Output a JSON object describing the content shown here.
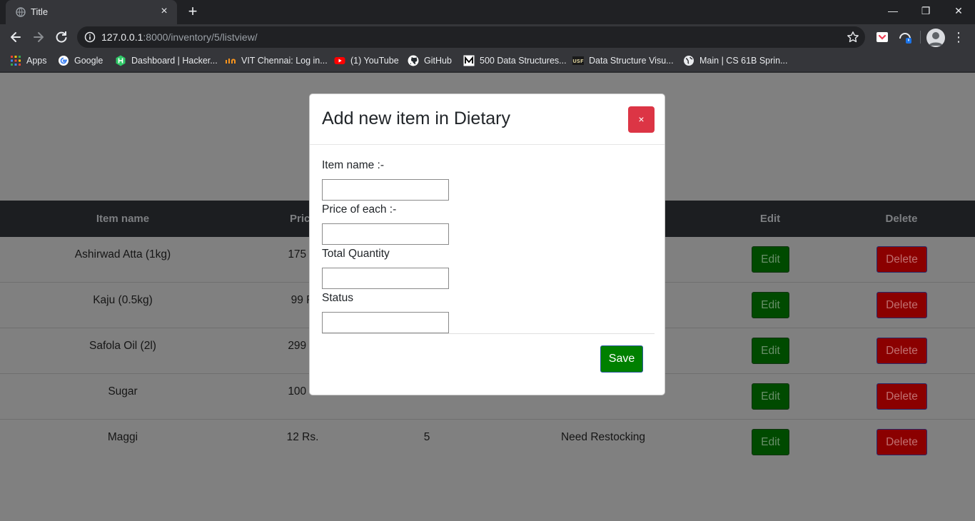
{
  "browser": {
    "tab_title": "Title",
    "tab_close": "×",
    "new_tab": "+",
    "url_host": "127.0.0.1",
    "url_path": ":8000/inventory/5/listview/",
    "window": {
      "minimize": "—",
      "restore": "❐",
      "close": "✕"
    },
    "menu": "⋮"
  },
  "bookmarks": [
    {
      "label": "Apps",
      "icon": "apps-grid-icon",
      "color": "#ea4335"
    },
    {
      "label": "Google",
      "icon": "google-icon",
      "color": "#4285f4"
    },
    {
      "label": "Dashboard | Hacker...",
      "icon": "hackerrank-icon",
      "color": "#2ec866"
    },
    {
      "label": "VIT Chennai: Log in...",
      "icon": "vit-icon",
      "color": "#f7941d"
    },
    {
      "label": "(1) YouTube",
      "icon": "youtube-icon",
      "color": "#ff0000"
    },
    {
      "label": "GitHub",
      "icon": "github-icon",
      "color": "#ffffff"
    },
    {
      "label": "500 Data Structures...",
      "icon": "medium-icon",
      "color": "#ffffff"
    },
    {
      "label": "Data Structure Visu...",
      "icon": "usf-icon",
      "color": "#cfc493"
    },
    {
      "label": "Main | CS 61B Sprin...",
      "icon": "globe-icon",
      "color": "#e8eaed"
    }
  ],
  "table": {
    "headers": [
      "Item name",
      "Pric",
      "Edit",
      "Delete"
    ],
    "rows": [
      {
        "name": "Ashirwad Atta (1kg)",
        "price": "175 R",
        "qty": "",
        "status": ""
      },
      {
        "name": "Kaju (0.5kg)",
        "price": "99 R",
        "qty": "",
        "status": ""
      },
      {
        "name": "Safola Oil (2l)",
        "price": "299 R",
        "qty": "",
        "status": ""
      },
      {
        "name": "Sugar",
        "price": "100 R",
        "qty": "",
        "status": ""
      },
      {
        "name": "Maggi",
        "price": "12 Rs.",
        "qty": "5",
        "status": "Need Restocking"
      }
    ],
    "edit_label": "Edit",
    "delete_label": "Delete"
  },
  "modal": {
    "title": "Add new item in Dietary",
    "close": "×",
    "fields": [
      {
        "label": "Item name :-",
        "value": ""
      },
      {
        "label": "Price of each :-",
        "value": ""
      },
      {
        "label": "Total Quantity",
        "value": ""
      },
      {
        "label": "Status",
        "value": ""
      }
    ],
    "save": "Save"
  },
  "colors": {
    "edit_button": "#004a00",
    "delete_button": "#8b0000",
    "close_button": "#dc3545",
    "save_button": "#008000",
    "overlay": "#808080"
  }
}
